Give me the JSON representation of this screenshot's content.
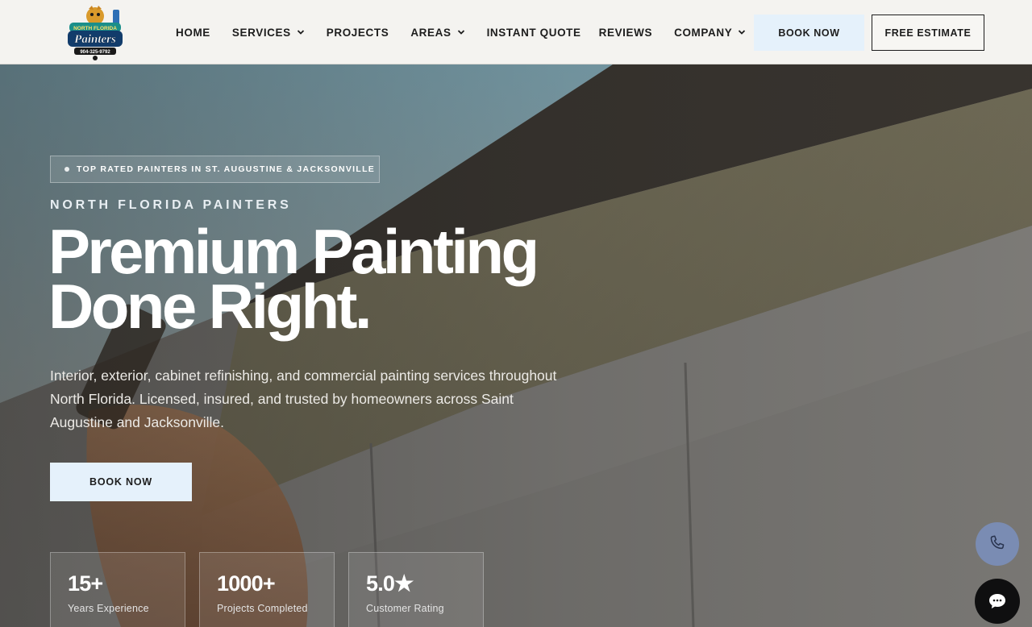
{
  "header": {
    "logo": {
      "top_text": "NORTH FLORIDA",
      "brand": "Painters",
      "phone": "904-325-9792"
    },
    "nav": [
      {
        "label": "HOME",
        "dropdown": false
      },
      {
        "label": "SERVICES",
        "dropdown": true
      },
      {
        "label": "PROJECTS",
        "dropdown": false
      },
      {
        "label": "AREAS",
        "dropdown": true
      },
      {
        "label": "INSTANT QUOTE",
        "dropdown": false
      },
      {
        "label": "REVIEWS",
        "dropdown": false
      },
      {
        "label": "COMPANY",
        "dropdown": true
      }
    ],
    "book_now": "BOOK NOW",
    "free_estimate": "FREE ESTIMATE"
  },
  "hero": {
    "badge": "TOP RATED PAINTERS IN ST. AUGUSTINE & JACKSONVILLE",
    "eyebrow": "NORTH FLORIDA PAINTERS",
    "title_line1": "Premium Painting",
    "title_line2": "Done Right.",
    "description": "Interior, exterior, cabinet refinishing, and commercial painting services throughout North Florida. Licensed, insured, and trusted by homeowners across Saint Augustine and Jacksonville.",
    "cta": "BOOK NOW",
    "stats": [
      {
        "value": "15+",
        "label": "Years Experience"
      },
      {
        "value": "1000+",
        "label": "Projects Completed"
      },
      {
        "value": "5.0★",
        "label": "Customer Rating"
      }
    ]
  },
  "floating": {
    "phone_icon": "phone-icon",
    "chat_icon": "chat-bubble-icon"
  },
  "colors": {
    "accent_light": "#e5f1fb",
    "text_dark": "#1d1d1d",
    "phone_button": "#7a8cb3",
    "chat_button": "#0f0f10"
  }
}
